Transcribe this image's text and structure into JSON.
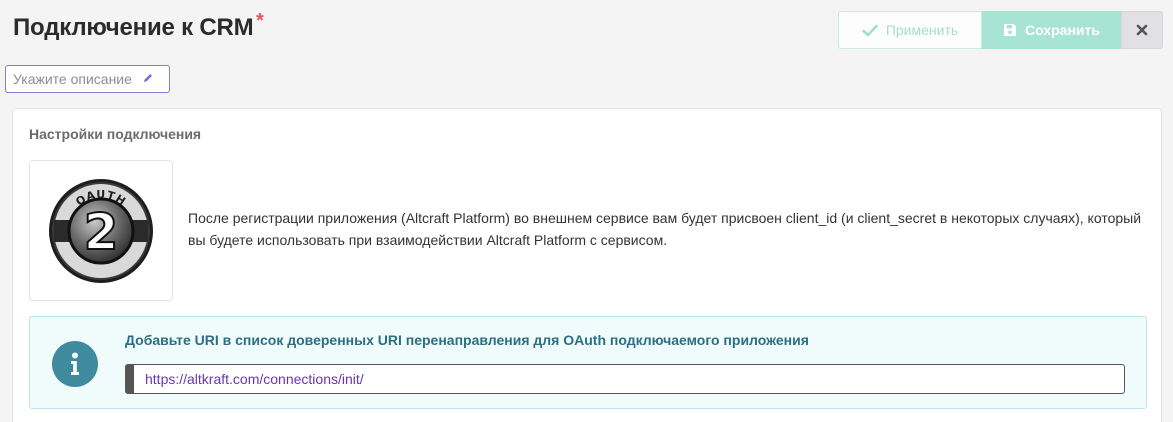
{
  "header": {
    "title": "Подключение к CRM",
    "required_mark": "*",
    "apply_label": "Применить",
    "save_label": "Сохранить"
  },
  "description": {
    "placeholder": "Укажите описание"
  },
  "settings": {
    "section_title": "Настройки подключения",
    "logo_top_text": "OAUTH",
    "logo_number": "2",
    "info_text": "После регистрации приложения (Altcraft Platform) во внешнем сервисе вам будет присвоен client_id (и client_secret в некоторых случаях), который вы будете использовать при взаимодействии Altcraft Platform с сервисом."
  },
  "alert": {
    "title": "Добавьте URI в список доверенных URI перенаправления для OAuth подключаемого приложения",
    "uri": "https://altkraft.com/connections/init/"
  },
  "colors": {
    "accent": "#a7e4d3",
    "info": "#3f8a9c",
    "link": "#6a36b0"
  }
}
